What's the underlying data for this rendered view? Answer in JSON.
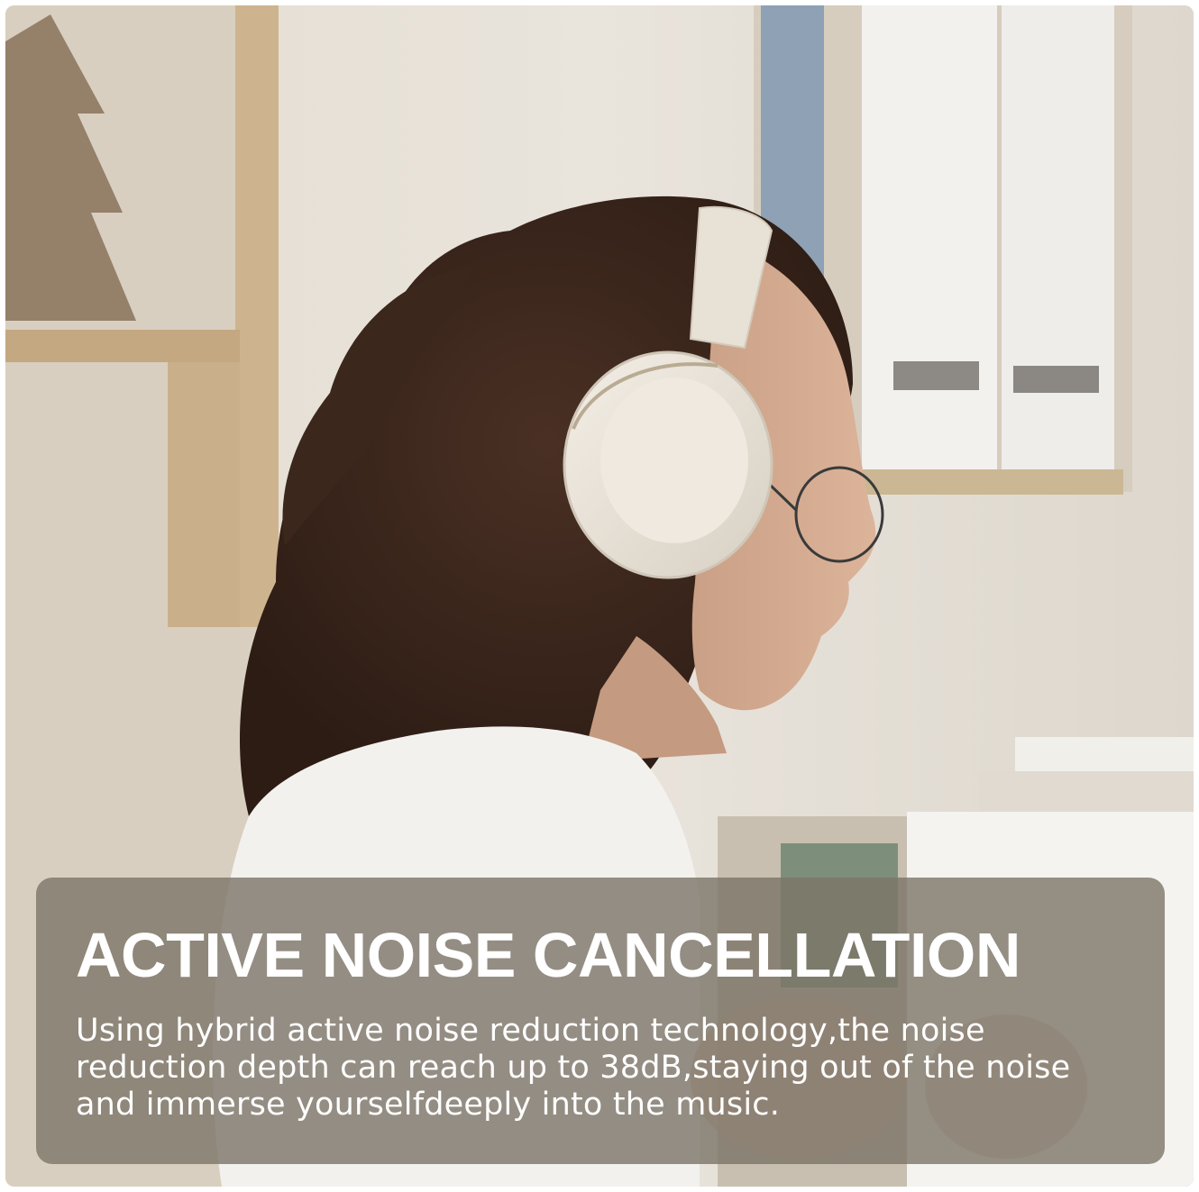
{
  "banner": {
    "headline": "ACTIVE NOISE CANCELLATION",
    "body": "Using hybrid active noise reduction technology,the noise reduction depth can reach up to 38dB,staying out of the noise and immerse yourselfdeeply into the music."
  },
  "colors": {
    "panel": "#7c7468",
    "text": "#ffffff",
    "headphones": "#ece6dc",
    "hair": "#3a261b",
    "shirt": "#f3f1ee"
  }
}
